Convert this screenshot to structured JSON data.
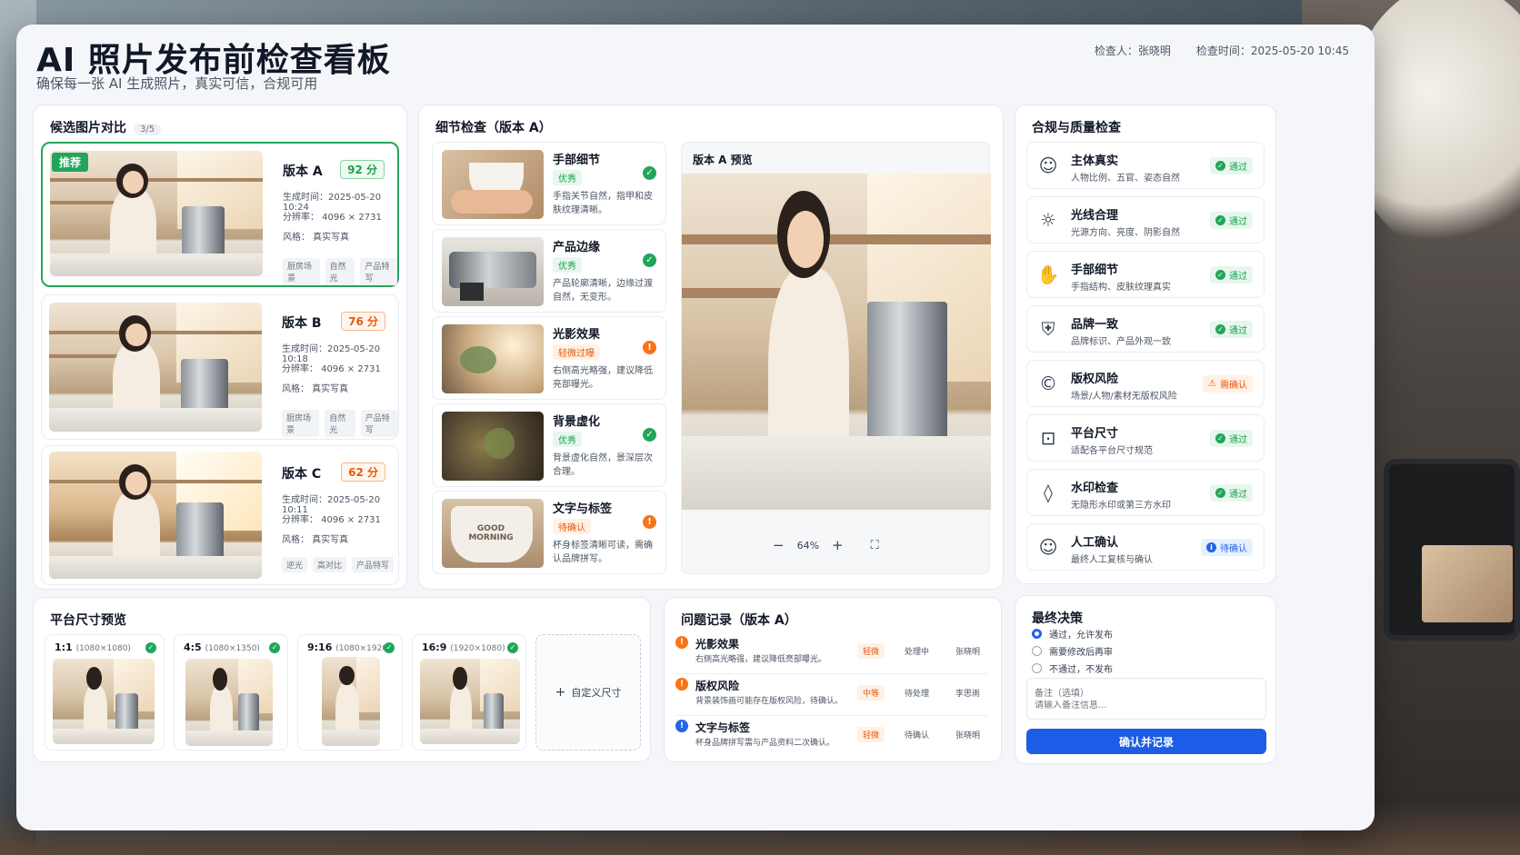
{
  "header": {
    "title": "AI 照片发布前检查看板",
    "subtitle": "确保每一张 AI 生成照片，真实可信，合规可用",
    "inspector": "检查人：张晓明",
    "time": "检查时间：2025-05-20 10:45"
  },
  "candidates": {
    "title": "候选图片对比",
    "count": "3/5",
    "items": [
      {
        "recommend": "推荐",
        "name": "版本 A",
        "score": "92 分",
        "time": "生成时间：2025-05-20 10:24",
        "res": "分辨率：  4096 × 2731",
        "style": "风格：  真实写真",
        "tags": [
          "厨房场景",
          "自然光",
          "产品特写"
        ]
      },
      {
        "name": "版本 B",
        "score": "76 分",
        "time": "生成时间：2025-05-20 10:18",
        "res": "分辨率：  4096 × 2731",
        "style": "风格：  真实写真",
        "tags": [
          "厨房场景",
          "自然光",
          "产品特写"
        ]
      },
      {
        "name": "版本 C",
        "score": "62 分",
        "time": "生成时间：2025-05-20 10:11",
        "res": "分辨率：  4096 × 2731",
        "style": "风格：  真实写真",
        "tags": [
          "逆光",
          "高对比",
          "产品特写"
        ]
      }
    ]
  },
  "details": {
    "title": "细节检查（版本 A）",
    "items": [
      {
        "name": "手部细节",
        "level": "优秀",
        "desc": "手指关节自然，指甲和皮肤纹理清晰。"
      },
      {
        "name": "产品边缘",
        "level": "优秀",
        "desc": "产品轮廓清晰，边缘过渡自然，无变形。"
      },
      {
        "name": "光影效果",
        "level": "轻微过曝",
        "desc": "右侧高光略强，建议降低亮部曝光。"
      },
      {
        "name": "背景虚化",
        "level": "优秀",
        "desc": "背景虚化自然，景深层次合理。"
      },
      {
        "name": "文字与标签",
        "level": "待确认",
        "desc": "杯身标签清晰可读，需确认品牌拼写。",
        "cup_text": "GOOD MORNING"
      }
    ],
    "preview_title": "版本 A 预览",
    "zoom": "64%"
  },
  "compliance": {
    "title": "合规与质量检查",
    "items": [
      {
        "icon": "person-icon",
        "name": "主体真实",
        "desc": "人物比例、五官、姿态自然",
        "status": "通过"
      },
      {
        "icon": "sun-icon",
        "name": "光线合理",
        "desc": "光源方向、亮度、阴影自然",
        "status": "通过"
      },
      {
        "icon": "hand-icon",
        "name": "手部细节",
        "desc": "手指结构、皮肤纹理真实",
        "status": "通过"
      },
      {
        "icon": "shield-icon",
        "name": "品牌一致",
        "desc": "品牌标识、产品外观一致",
        "status": "通过"
      },
      {
        "icon": "copyright-icon",
        "name": "版权风险",
        "desc": "场景/人物/素材无版权风险",
        "status": "需确认"
      },
      {
        "icon": "ruler-icon",
        "name": "平台尺寸",
        "desc": "适配各平台尺寸规范",
        "status": "通过"
      },
      {
        "icon": "droplet-icon",
        "name": "水印检查",
        "desc": "无隐形水印或第三方水印",
        "status": "通过"
      },
      {
        "icon": "user-check-icon",
        "name": "人工确认",
        "desc": "最终人工复核与确认",
        "status": "待确认"
      }
    ]
  },
  "platform": {
    "title": "平台尺寸预览",
    "items": [
      {
        "ratio": "1:1",
        "size": "(1080×1080)"
      },
      {
        "ratio": "4:5",
        "size": "(1080×1350)"
      },
      {
        "ratio": "9:16",
        "size": "(1080×1920)"
      },
      {
        "ratio": "16:9",
        "size": "(1920×1080)"
      }
    ],
    "custom": "自定义尺寸"
  },
  "issues": {
    "title": "问题记录（版本 A）",
    "items": [
      {
        "name": "光影效果",
        "desc": "右侧高光略强，建议降低亮部曝光。",
        "severity": "轻微",
        "status": "处理中",
        "owner": "张晓明"
      },
      {
        "name": "版权风险",
        "desc": "背景装饰画可能存在版权风险，待确认。",
        "severity": "中等",
        "status": "待处理",
        "owner": "李思雨"
      },
      {
        "name": "文字与标签",
        "desc": "杯身品牌拼写需与产品资料二次确认。",
        "severity": "轻微",
        "status": "待确认",
        "owner": "张晓明"
      }
    ]
  },
  "decision": {
    "title": "最终决策",
    "options": [
      "通过，允许发布",
      "需要修改后再审",
      "不通过，不发布"
    ],
    "note_label": "备注（选填）",
    "note_placeholder": "请输入备注信息...",
    "confirm": "确认并记录"
  }
}
